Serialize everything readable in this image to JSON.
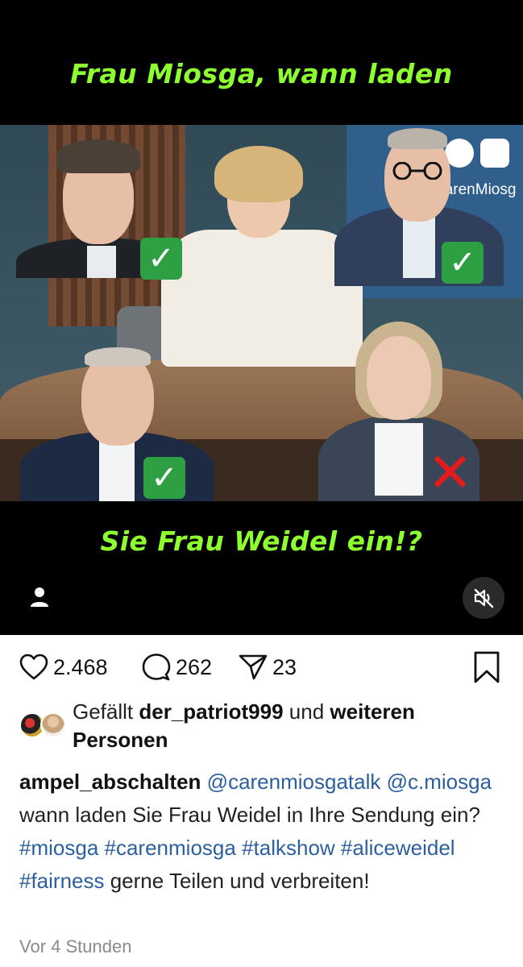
{
  "media": {
    "caption_top": "Frau Miosga, wann laden",
    "caption_bottom": "Sie Frau Weidel ein!?",
    "screen_text": "CarenMiosg",
    "check_symbol": "✓",
    "cross_symbol": "✕"
  },
  "icons": {
    "user": "user-icon",
    "mute": "speaker-muted-icon",
    "like": "heart-icon",
    "comment": "comment-bubble-icon",
    "share": "paper-plane-icon",
    "save": "bookmark-icon"
  },
  "actions": {
    "likes_count": "2.468",
    "comments_count": "262",
    "shares_count": "23"
  },
  "likes": {
    "prefix": "Gefällt ",
    "user": "der_patriot999",
    "middle": " und ",
    "suffix": "weiteren Personen"
  },
  "caption": {
    "username": "ampel_abschalten",
    "parts": [
      {
        "text": " ",
        "type": "plain"
      },
      {
        "text": "@carenmiosgatalk",
        "type": "tag"
      },
      {
        "text": " ",
        "type": "plain"
      },
      {
        "text": "@c.miosga",
        "type": "tag"
      },
      {
        "text": " wann laden Sie Frau Weidel in Ihre Sendung ein? ",
        "type": "plain"
      },
      {
        "text": "#miosga",
        "type": "tag"
      },
      {
        "text": " ",
        "type": "plain"
      },
      {
        "text": "#carenmiosga",
        "type": "tag"
      },
      {
        "text": " ",
        "type": "plain"
      },
      {
        "text": "#talkshow",
        "type": "tag"
      },
      {
        "text": " ",
        "type": "plain"
      },
      {
        "text": "#aliceweidel",
        "type": "tag"
      },
      {
        "text": " ",
        "type": "plain"
      },
      {
        "text": "#fairness",
        "type": "tag"
      },
      {
        "text": " gerne Teilen und verbreiten!",
        "type": "plain"
      }
    ]
  },
  "timestamp": "Vor 4 Stunden",
  "colors": {
    "caption_green": "#8dff2f",
    "hashtag_blue": "#2c5f9e",
    "check_green": "#2ea043",
    "cross_red": "#e31b1b"
  }
}
